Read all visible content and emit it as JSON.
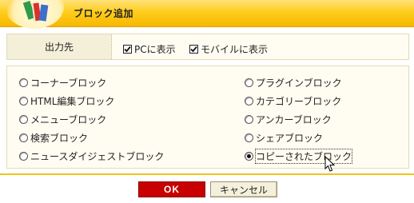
{
  "header": {
    "title": "ブロック追加"
  },
  "target": {
    "label": "出力先",
    "options": [
      {
        "label": "PCに表示",
        "checked": true
      },
      {
        "label": "モバイルに表示",
        "checked": true
      }
    ]
  },
  "block_types": {
    "left": [
      {
        "label": "コーナーブロック",
        "selected": false
      },
      {
        "label": "HTML編集ブロック",
        "selected": false
      },
      {
        "label": "メニューブロック",
        "selected": false
      },
      {
        "label": "検索ブロック",
        "selected": false
      },
      {
        "label": "ニュースダイジェストブロック",
        "selected": false
      }
    ],
    "right": [
      {
        "label": "プラグインブロック",
        "selected": false
      },
      {
        "label": "カテゴリーブロック",
        "selected": false
      },
      {
        "label": "アンカーブロック",
        "selected": false
      },
      {
        "label": "シェアブロック",
        "selected": false
      },
      {
        "label": "コピーされたブロック",
        "selected": true
      }
    ]
  },
  "buttons": {
    "ok": "OK",
    "cancel": "キャンセル"
  },
  "colors": {
    "accent": "#ffcd1c",
    "ok_button": "#c80000"
  }
}
